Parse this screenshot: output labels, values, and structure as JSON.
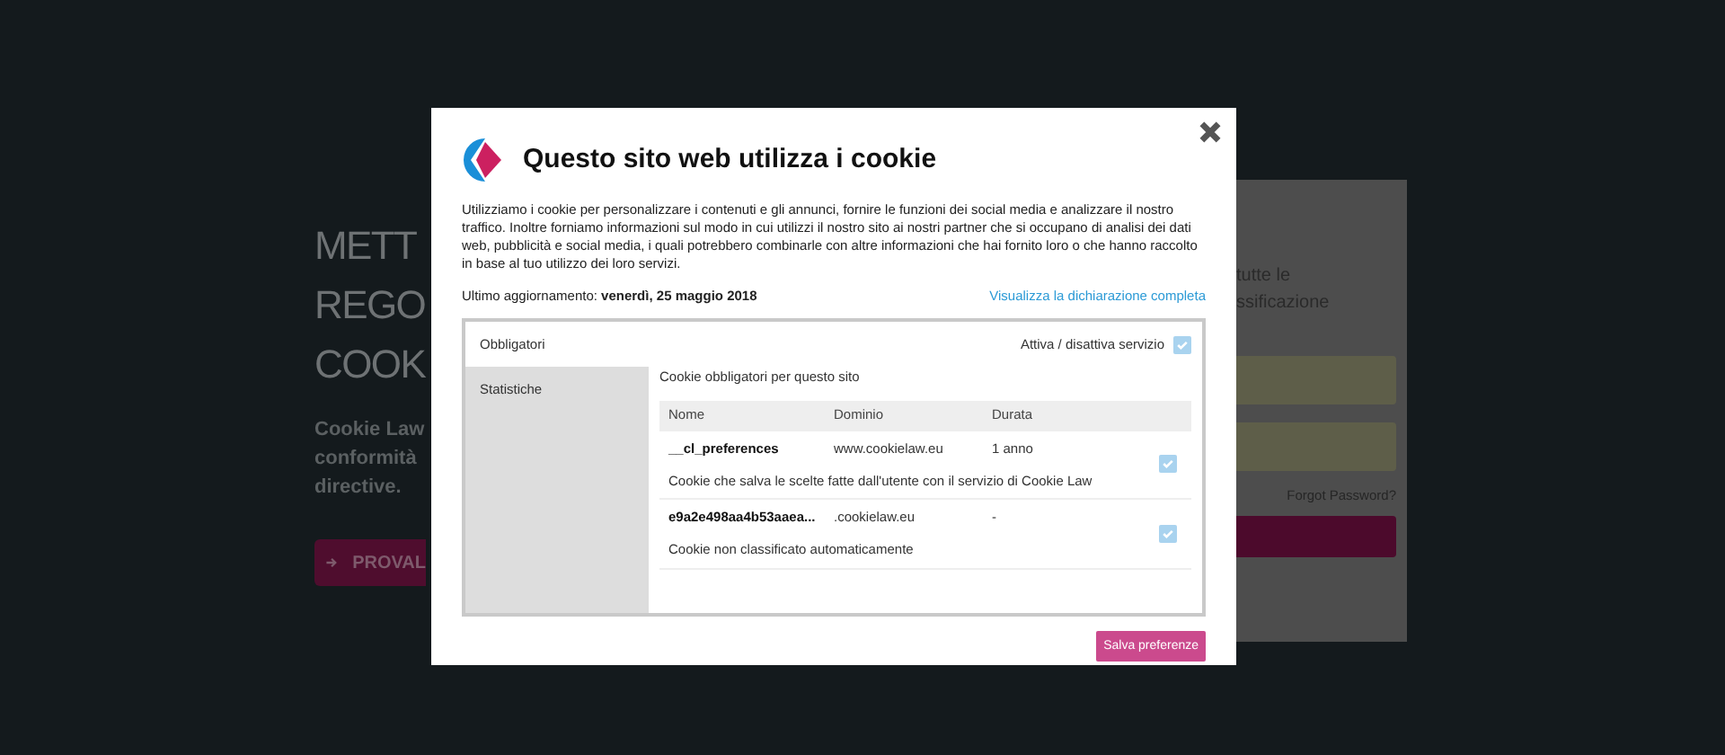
{
  "hero": {
    "heading_lines": [
      "METT",
      "REGO",
      "COOK"
    ],
    "text_lines": [
      "Cookie Law",
      "conformità",
      "directive."
    ],
    "button": "PROVAL"
  },
  "login": {
    "text_lines": [
      "tutte le",
      "ssificazione"
    ],
    "forgot_link": "Forgot Password?"
  },
  "dialog": {
    "title": "Questo sito web utilizza i cookie",
    "description": "Utilizziamo i cookie per personalizzare i contenuti e gli annunci, fornire le funzioni dei social media e analizzare il nostro traffico. Inoltre forniamo informazioni sul modo in cui utilizzi il nostro sito ai nostri partner che si occupano di analisi dei dati web, pubblicità e social media, i quali potrebbero combinarle con altre informazioni che hai fornito loro o che hanno raccolto in base al tuo utilizzo dei loro servizi.",
    "updated": "Ultimo aggiornamento: **venerdì, 25 maggio 2018**",
    "full_link": "Visualizza la dichiarazione completa",
    "tabs": [
      {
        "label": "Obbligatori",
        "selected": true
      },
      {
        "label": "Statistiche",
        "selected": false
      }
    ],
    "toggle": {
      "label": "Attiva / disattiva servizio",
      "checked": true
    },
    "section_title": "Cookie obbligatori per questo sito",
    "table": {
      "columns": [
        "Nome",
        "Dominio",
        "Durata"
      ],
      "rows": [
        {
          "name": "__cl_preferences",
          "domain": "www.cookielaw.eu",
          "duration": "1 anno",
          "description": "Cookie che salva le scelte fatte dall'utente con il servizio di Cookie Law",
          "checked": true
        },
        {
          "name": "e9a2e498aa4b53aaea...",
          "domain": ".cookielaw.eu",
          "duration": "-",
          "description": "Cookie non classificato automaticamente",
          "checked": true
        }
      ]
    },
    "save_button": "Salva preferenze"
  }
}
